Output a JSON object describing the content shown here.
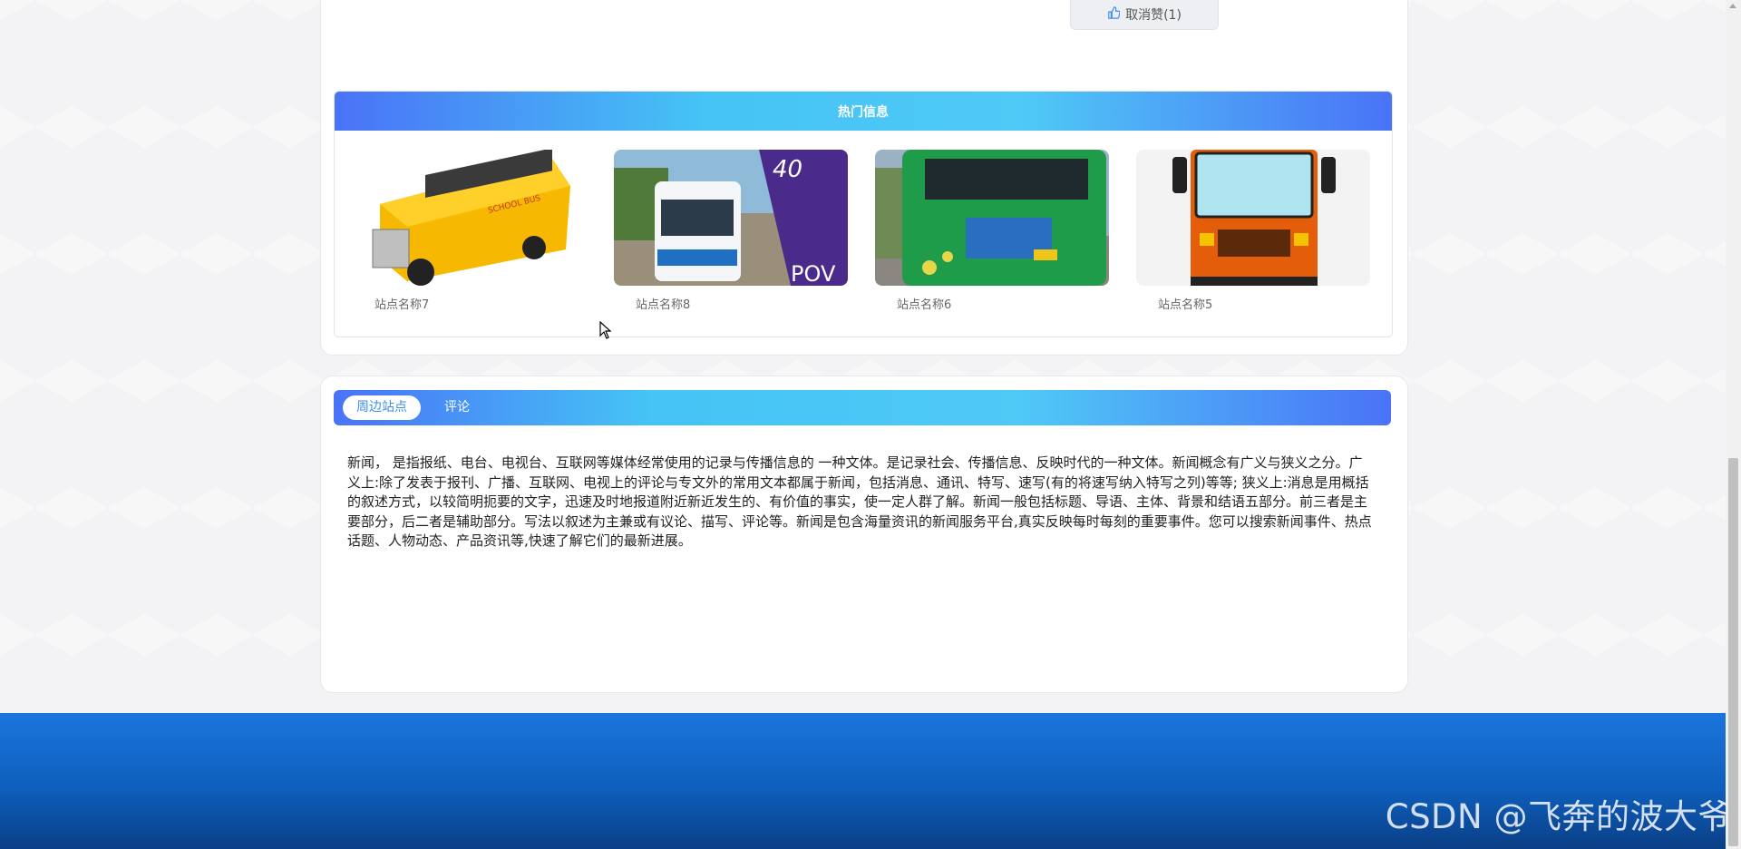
{
  "like_button": {
    "label": "取消赞(1)",
    "icon": "thumbs-up-icon"
  },
  "hot_info": {
    "title": "热门信息",
    "items": [
      {
        "caption": "站点名称7",
        "image": "yellow-school-bus-toy"
      },
      {
        "caption": "站点名称8",
        "image": "city-bus-40-pov"
      },
      {
        "caption": "站点名称6",
        "image": "green-city-bus-rear"
      },
      {
        "caption": "站点名称5",
        "image": "orange-bus-front-illustration"
      }
    ]
  },
  "tabs": [
    {
      "label": "周边站点",
      "active": true
    },
    {
      "label": "评论",
      "active": false
    }
  ],
  "description": "新闻， 是指报纸、电台、电视台、互联网等媒体经常使用的记录与传播信息的 一种文体。是记录社会、传播信息、反映时代的一种文体。新闻概念有广义与狭义之分。广义上:除了发表于报刊、广播、互联网、电视上的评论与专文外的常用文本都属于新闻，包括消息、通讯、特写、速写(有的将速写纳入特写之列)等等; 狭义上:消息是用概括的叙述方式，以较简明扼要的文字，迅速及时地报道附近新近发生的、有价值的事实，使一定人群了解。新闻一般包括标题、导语、主体、背景和结语五部分。前三者是主要部分，后二者是辅助部分。写法以叙述为主兼或有议论、描写、评论等。新闻是包含海量资讯的新闻服务平台,真实反映每时每刻的重要事件。您可以搜索新闻事件、热点话题、人物动态、产品资讯等,快速了解它们的最新进展。",
  "watermark": "CSDN @飞奔的波大爷",
  "colors": {
    "accent_blue": "#4a73f7",
    "accent_cyan": "#45c4f5",
    "footer_blue": "#1b75dd"
  }
}
